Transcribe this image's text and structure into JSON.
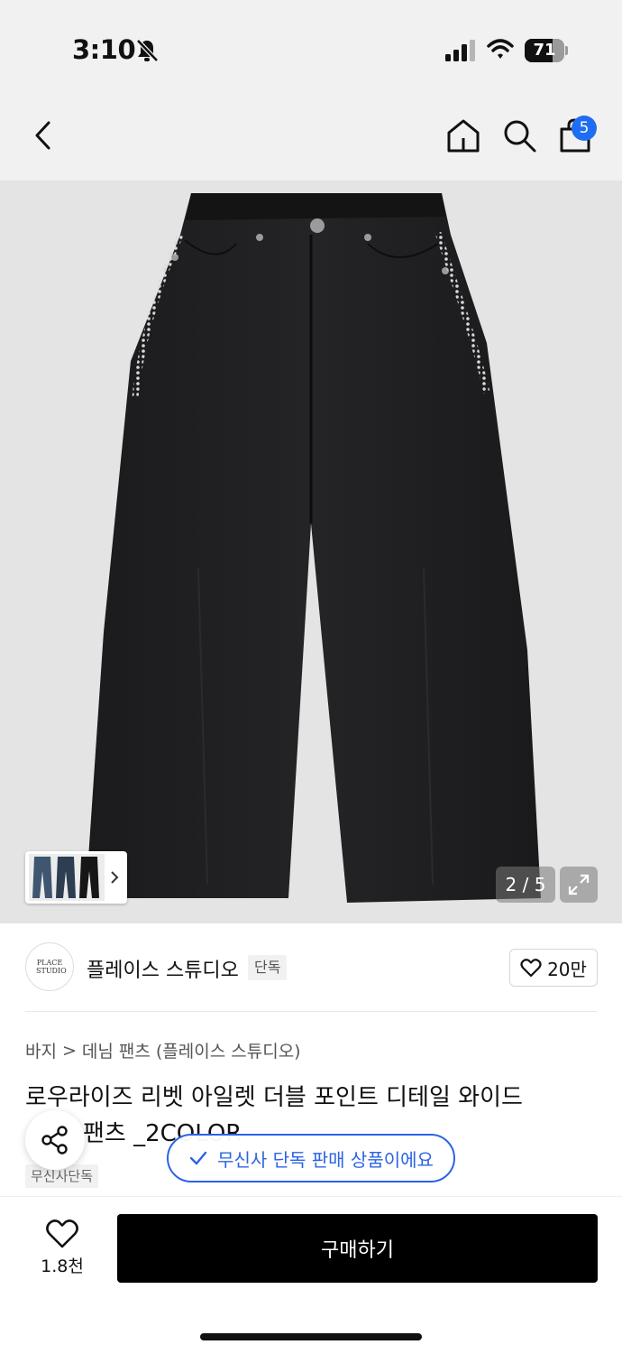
{
  "status_bar": {
    "time": "3:10",
    "battery": "71",
    "battery_level": 0.71
  },
  "nav": {
    "cart_count": "5"
  },
  "gallery": {
    "counter": "2 / 5",
    "total_images": 5,
    "current_image": 2
  },
  "brand": {
    "logo_text": "PLACE STUDIO",
    "name": "플레이스 스튜디오",
    "tag": "단독",
    "likes": "20만"
  },
  "breadcrumb": {
    "category": "바지",
    "separator": ">",
    "subcategory": "데님 팬츠 (플레이스 스튜디오)"
  },
  "product": {
    "title_line1": "로우라이즈 리벳 아일렛 더블 포인트 디테일 와이드",
    "title_line2": "팬츠 _2COLOR",
    "store_tag": "무신사단독"
  },
  "toast": {
    "text": "무신사 단독 판매 상품이에요"
  },
  "bottom_bar": {
    "wish_count": "1.8천",
    "buy_label": "구매하기"
  },
  "colors": {
    "accent_blue": "#2b63e6",
    "badge_blue": "#1f6df2",
    "buy_button": "#000000"
  }
}
